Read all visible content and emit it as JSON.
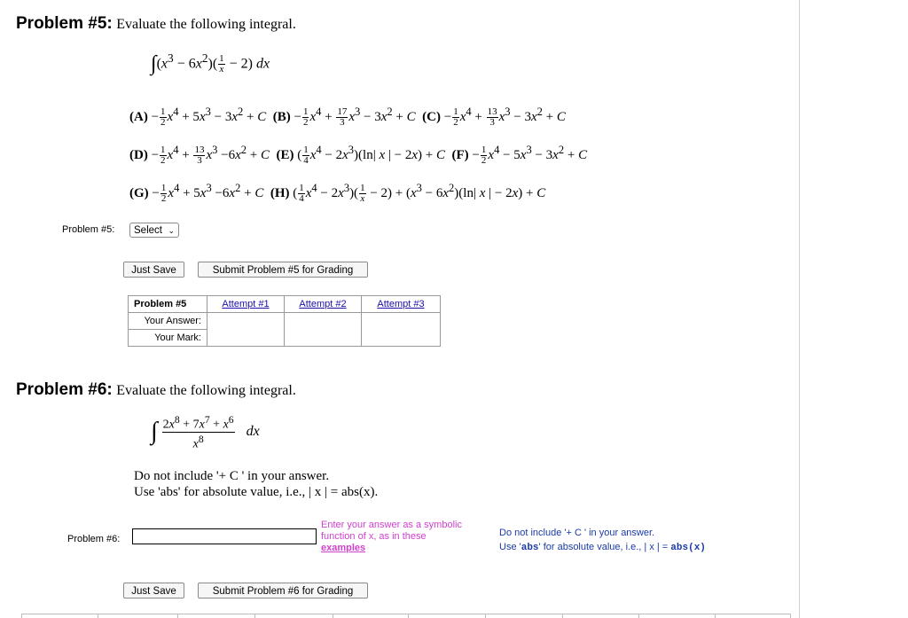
{
  "p5": {
    "title": "Problem #5:",
    "prompt": "Evaluate the following integral.",
    "options": {
      "A": {
        "label": "(A)"
      },
      "B": {
        "label": "(B)"
      },
      "C": {
        "label": "(C)"
      },
      "D": {
        "label": "(D)"
      },
      "E": {
        "label": "(E)"
      },
      "F": {
        "label": "(F)"
      },
      "G": {
        "label": "(G)"
      },
      "H": {
        "label": "(H)"
      }
    },
    "answer_label": "Problem #5:",
    "select_value": "Select",
    "just_save": "Just Save",
    "submit": "Submit Problem #5 for Grading",
    "table": {
      "header": "Problem #5",
      "attempts": [
        "Attempt #1",
        "Attempt #2",
        "Attempt #3"
      ],
      "your_answer": "Your Answer:",
      "your_mark": "Your Mark:"
    }
  },
  "p6": {
    "title": "Problem #6:",
    "prompt": "Evaluate the following integral.",
    "note1": "Do not include '+ C ' in your answer.",
    "note2": "Use 'abs' for absolute value, i.e., | x | = abs(x).",
    "answer_label": "Problem #6:",
    "input_value": "",
    "hint_text": "Enter your answer as a symbolic function of x, as in these",
    "hint_link": "examples",
    "side_note1": "Do not include '+ C ' in your answer.",
    "side_note2_pre": "Use '",
    "side_note2_abs": "abs",
    "side_note2_post": "' for absolute value, i.e., | x | = ",
    "side_note2_code": "abs(x)",
    "just_save": "Just Save",
    "submit": "Submit Problem #6 for Grading"
  }
}
